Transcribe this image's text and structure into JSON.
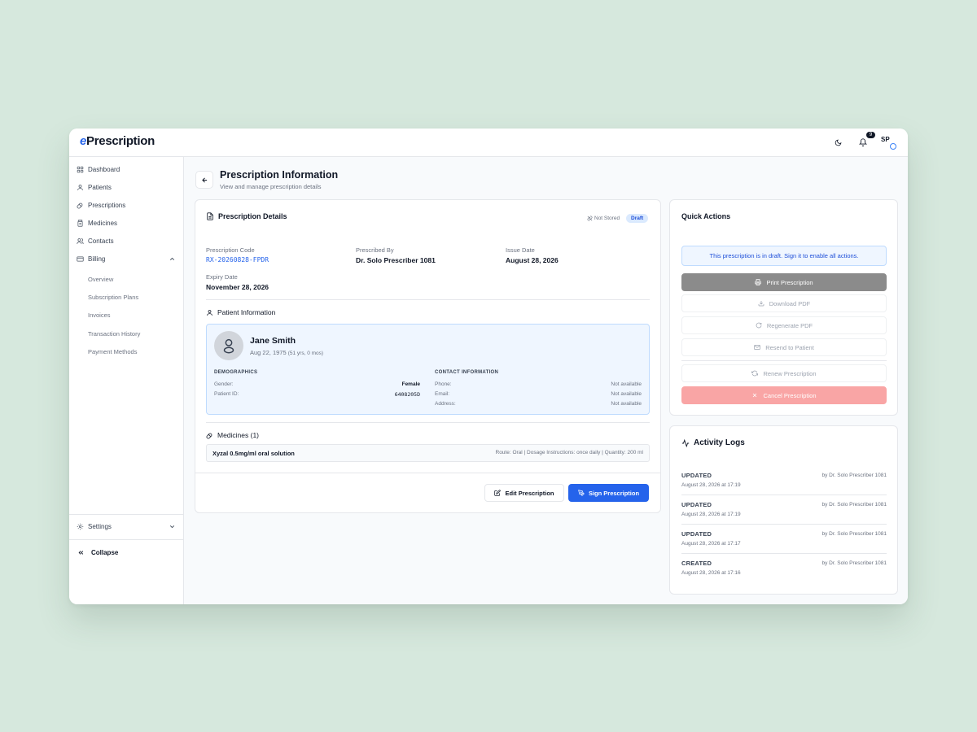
{
  "app": {
    "logo_prefix": "e",
    "logo_rest": "Prescription"
  },
  "topbar": {
    "notification_count": "9",
    "user_initials": "SP"
  },
  "sidebar": {
    "items": [
      {
        "label": "Dashboard",
        "icon": "grid-icon"
      },
      {
        "label": "Patients",
        "icon": "user-icon"
      },
      {
        "label": "Prescriptions",
        "icon": "pill-icon"
      },
      {
        "label": "Medicines",
        "icon": "bottle-icon"
      },
      {
        "label": "Contacts",
        "icon": "users-icon"
      },
      {
        "label": "Billing",
        "icon": "card-icon"
      }
    ],
    "billing_sub": [
      "Overview",
      "Subscription Plans",
      "Invoices",
      "Transaction History",
      "Payment Methods"
    ],
    "settings": "Settings",
    "collapse": "Collapse"
  },
  "page": {
    "title": "Prescription Information",
    "subtitle": "View and manage prescription details"
  },
  "details": {
    "title": "Prescription Details",
    "not_stored": "Not Stored",
    "status": "Draft",
    "code_label": "Prescription Code",
    "code": "RX-20260828-FPDR",
    "prescribed_by_label": "Prescribed By",
    "prescribed_by": "Dr. Solo Prescriber 1081",
    "issue_label": "Issue Date",
    "issue": "August 28, 2026",
    "expiry_label": "Expiry Date",
    "expiry": "November 28, 2026"
  },
  "patient": {
    "section_title": "Patient Information",
    "name": "Jane Smith",
    "dob": "Aug 22, 1975",
    "age": "(51 yrs, 0 mos)",
    "demographics_h": "DEMOGRAPHICS",
    "gender_label": "Gender:",
    "gender": "Female",
    "pid_label": "Patient ID:",
    "pid": "6408205D",
    "contact_h": "CONTACT INFORMATION",
    "phone_label": "Phone:",
    "phone": "Not available",
    "email_label": "Email:",
    "email": "Not available",
    "address_label": "Address:",
    "address": "Not available"
  },
  "medicines": {
    "title": "Medicines (1)",
    "items": [
      {
        "name": "Xyzal 0.5mg/ml oral solution",
        "info": "Route: Oral | Dosage Instructions: once daily | Quantity: 200 ml"
      }
    ]
  },
  "actions": {
    "edit": "Edit Prescription",
    "sign": "Sign Prescription"
  },
  "quick_actions": {
    "title": "Quick Actions",
    "banner": "This prescription is in draft. Sign it to enable all actions.",
    "print": "Print Prescription",
    "download": "Download PDF",
    "regenerate": "Regenerate PDF",
    "resend": "Resend to Patient",
    "renew": "Renew Prescription",
    "cancel": "Cancel Prescription"
  },
  "activity": {
    "title": "Activity Logs",
    "logs": [
      {
        "action": "UPDATED",
        "by": "by Dr. Solo Prescriber 1081",
        "time": "August 28, 2026 at 17:19"
      },
      {
        "action": "UPDATED",
        "by": "by Dr. Solo Prescriber 1081",
        "time": "August 28, 2026 at 17:19"
      },
      {
        "action": "UPDATED",
        "by": "by Dr. Solo Prescriber 1081",
        "time": "August 28, 2026 at 17:17"
      },
      {
        "action": "CREATED",
        "by": "by Dr. Solo Prescriber 1081",
        "time": "August 28, 2026 at 17:16"
      }
    ]
  },
  "colors": {
    "accent": "#2563eb",
    "draft_bg": "#dbeafe",
    "cancel": "#f9a5a5",
    "print": "#8b8b8b",
    "page_bg": "#d6e8dd"
  }
}
